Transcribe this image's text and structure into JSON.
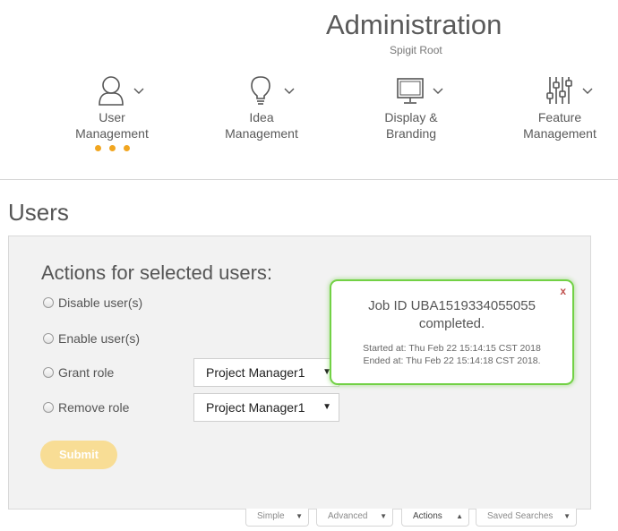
{
  "header": {
    "title": "Administration",
    "subtitle": "Spigit Root"
  },
  "nav": {
    "user_management": {
      "line1": "User",
      "line2": "Management",
      "icon": "user-icon"
    },
    "idea_management": {
      "line1": "Idea",
      "line2": "Management",
      "icon": "lightbulb-icon"
    },
    "display_branding": {
      "line1": "Display &",
      "line2": "Branding",
      "icon": "monitor-icon"
    },
    "feature_management": {
      "line1": "Feature",
      "line2": "Management",
      "icon": "sliders-icon"
    }
  },
  "page": {
    "title": "Users"
  },
  "actions": {
    "title": "Actions for selected users:",
    "disable_label": "Disable user(s)",
    "enable_label": "Enable user(s)",
    "grant_label": "Grant role",
    "remove_label": "Remove role",
    "grant_value": "Project Manager1",
    "remove_value": "Project Manager1",
    "submit_label": "Submit"
  },
  "toast": {
    "close": "x",
    "line1": "Job ID UBA1519334055055",
    "line2": "completed.",
    "started": "Started at: Thu Feb 22 15:14:15 CST 2018",
    "ended": "Ended at: Thu Feb 22 15:14:18 CST 2018."
  },
  "tabs": {
    "simple": "Simple",
    "advanced": "Advanced",
    "actions": "Actions",
    "saved": "Saved Searches"
  },
  "colors": {
    "accent": "#f1a620",
    "submit_disabled": "#f8dd95",
    "toast_border": "#72d145",
    "close": "#c0504d"
  }
}
